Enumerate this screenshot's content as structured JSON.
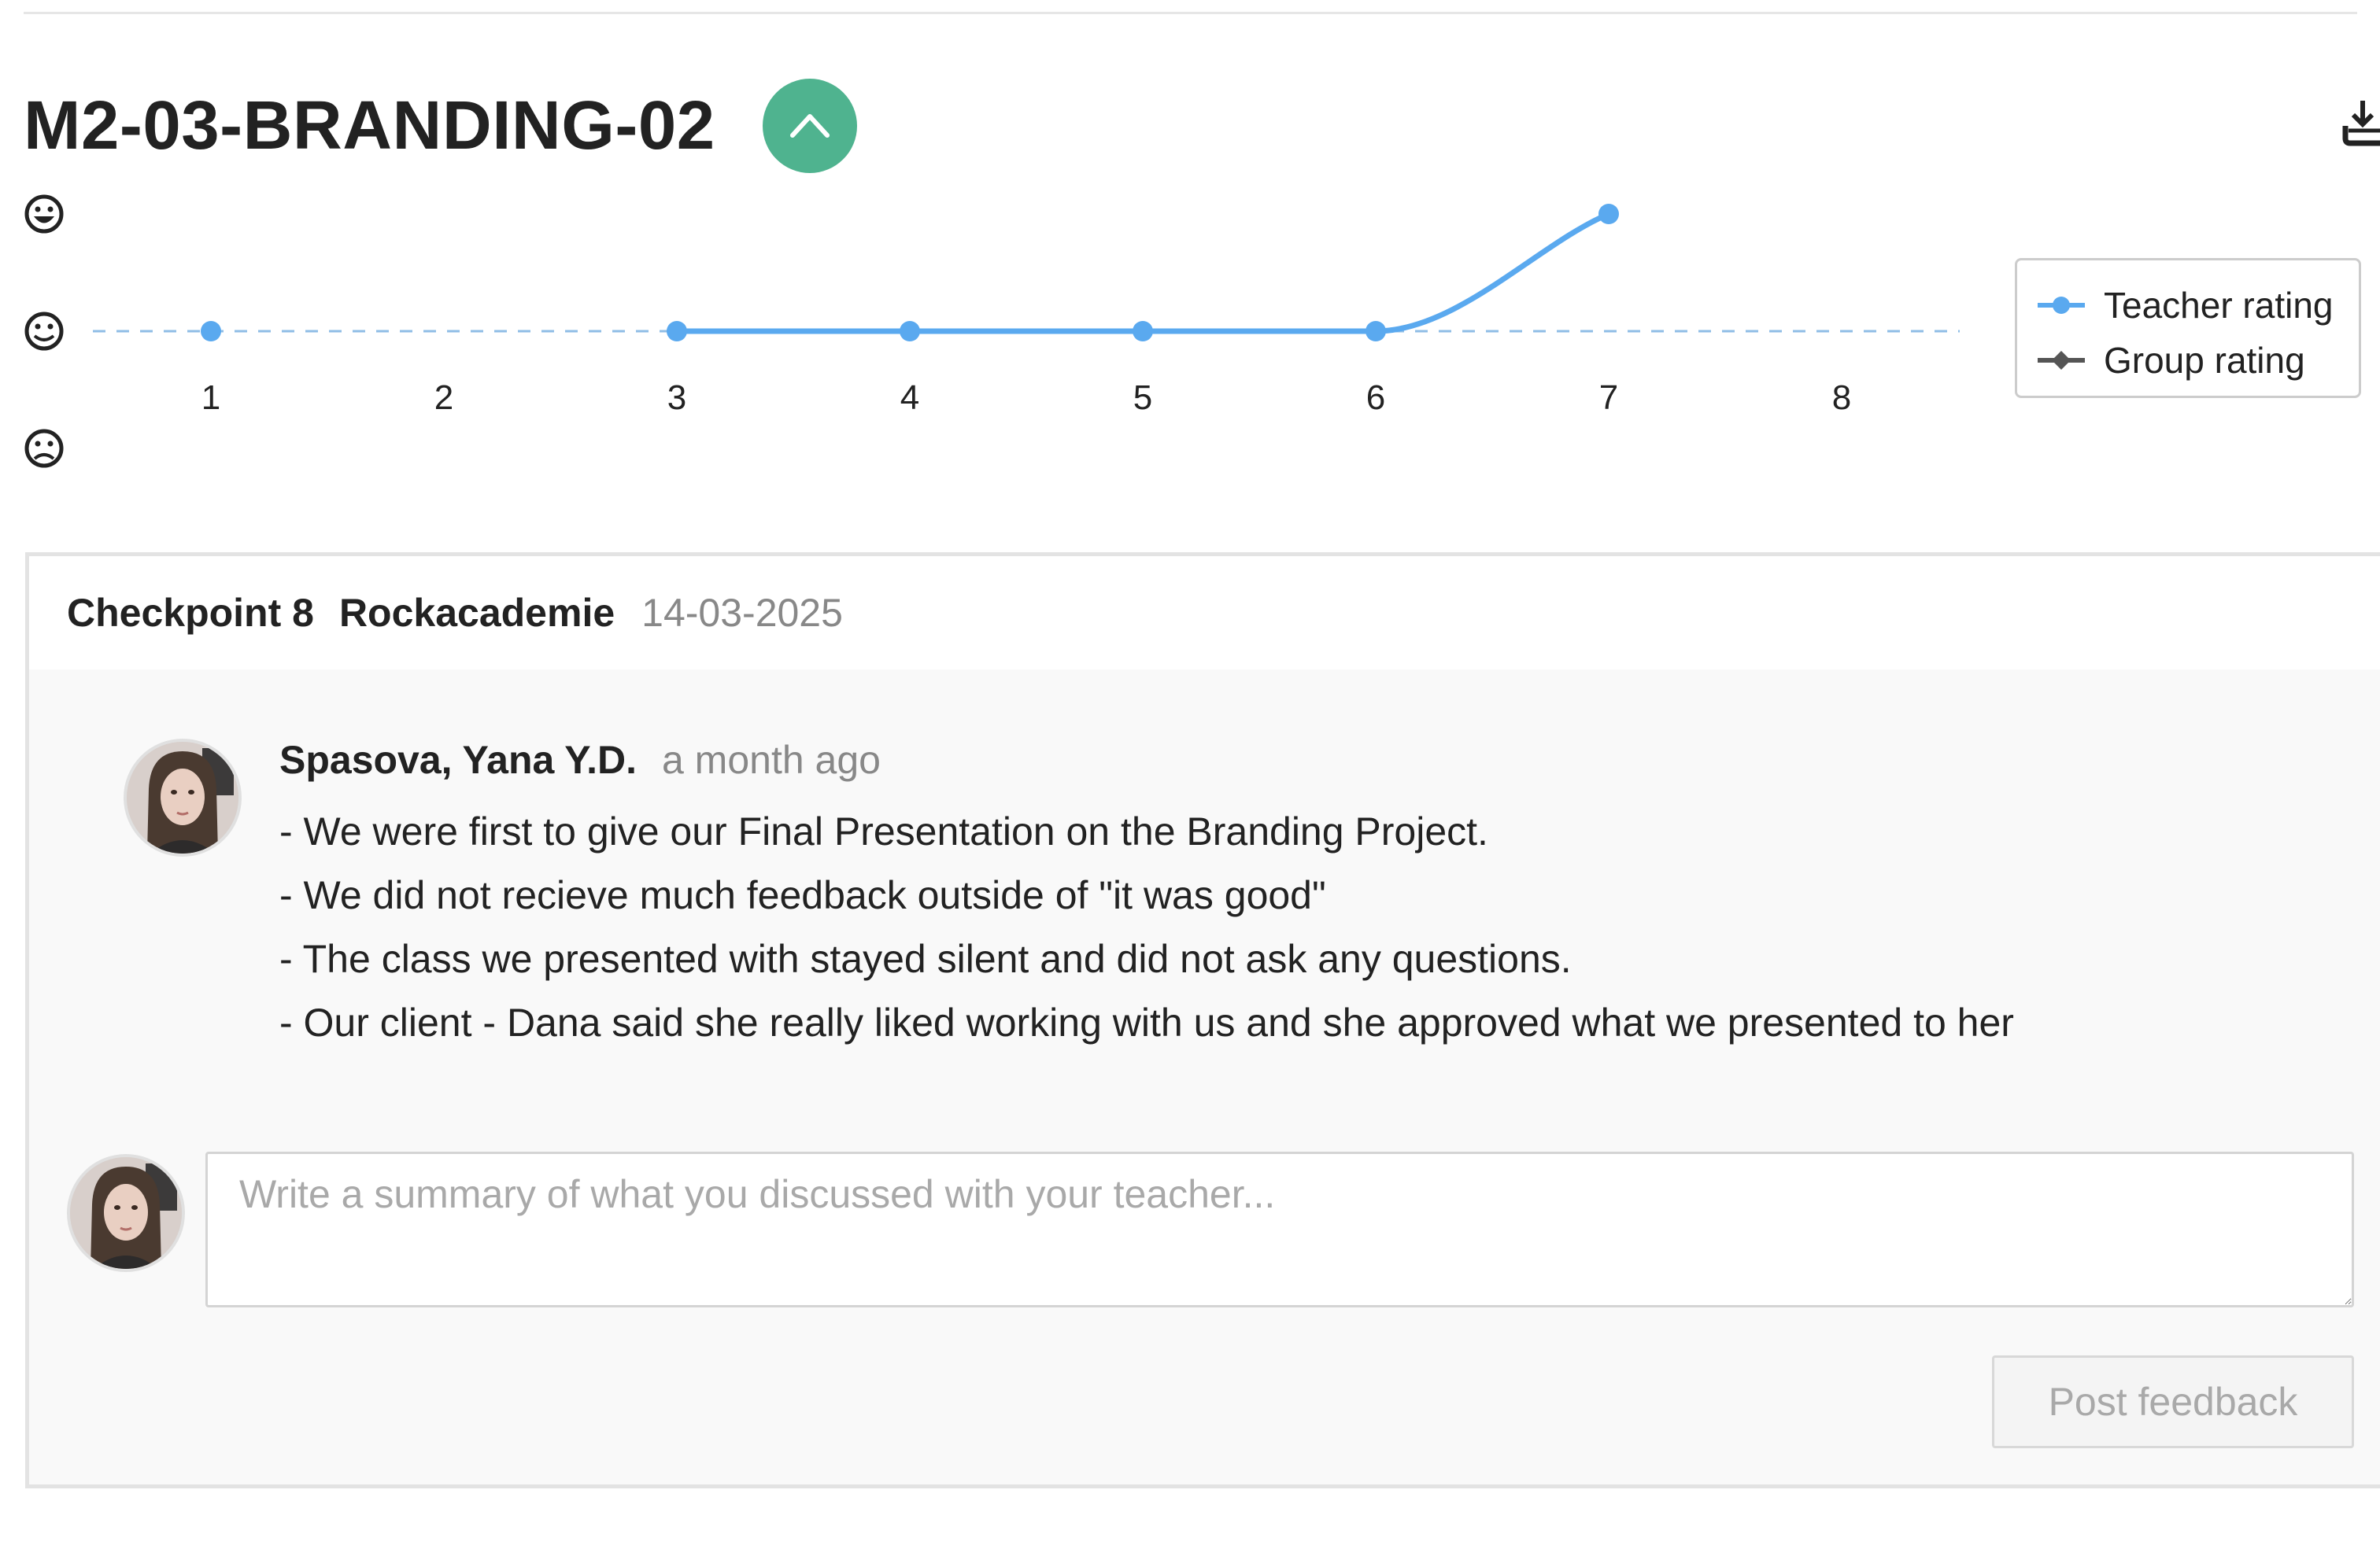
{
  "module": {
    "title": "M2-03-BRANDING-02",
    "toggle_icon": "chevron-up-icon",
    "download_icon": "download-icon"
  },
  "chart_data": {
    "type": "line",
    "x": [
      1,
      2,
      3,
      4,
      5,
      6,
      7,
      8
    ],
    "series": [
      {
        "name": "Teacher rating",
        "color": "#5aa9ef",
        "points": [
          {
            "x": 1,
            "y": 0
          },
          {
            "x": 3,
            "y": 0
          },
          {
            "x": 4,
            "y": 0
          },
          {
            "x": 5,
            "y": 0
          },
          {
            "x": 6,
            "y": 0
          },
          {
            "x": 7,
            "y": 1
          }
        ]
      },
      {
        "name": "Group rating",
        "color": "#555555",
        "points": []
      }
    ],
    "ylim": [
      -1,
      1
    ],
    "y_ticks": [
      {
        "value": 1,
        "icon": "happy-face-icon"
      },
      {
        "value": 0,
        "icon": "neutral-face-icon"
      },
      {
        "value": -1,
        "icon": "sad-face-icon"
      }
    ],
    "reference_line": {
      "y": 0,
      "style": "dashed"
    },
    "grid": false,
    "legend_position": "right"
  },
  "checkpoint": {
    "label": "Checkpoint 8",
    "organization": "Rockacademie",
    "date": "14-03-2025"
  },
  "comment": {
    "author": "Spasova, Yana Y.D.",
    "time": "a month ago",
    "lines": [
      "- We were first to give our Final Presentation on the Branding Project.",
      "- We did not recieve much feedback outside of \"it was good\"",
      "- The class we presented with stayed silent and did not ask any questions.",
      "- Our client - Dana said she really liked working with us and she approved what we presented to her"
    ]
  },
  "compose": {
    "placeholder": "Write a summary of what you discussed with your teacher...",
    "value": "",
    "post_label": "Post feedback"
  },
  "colors": {
    "accent": "#4fb38f",
    "line": "#5aa9ef",
    "muted_text": "#888888"
  }
}
